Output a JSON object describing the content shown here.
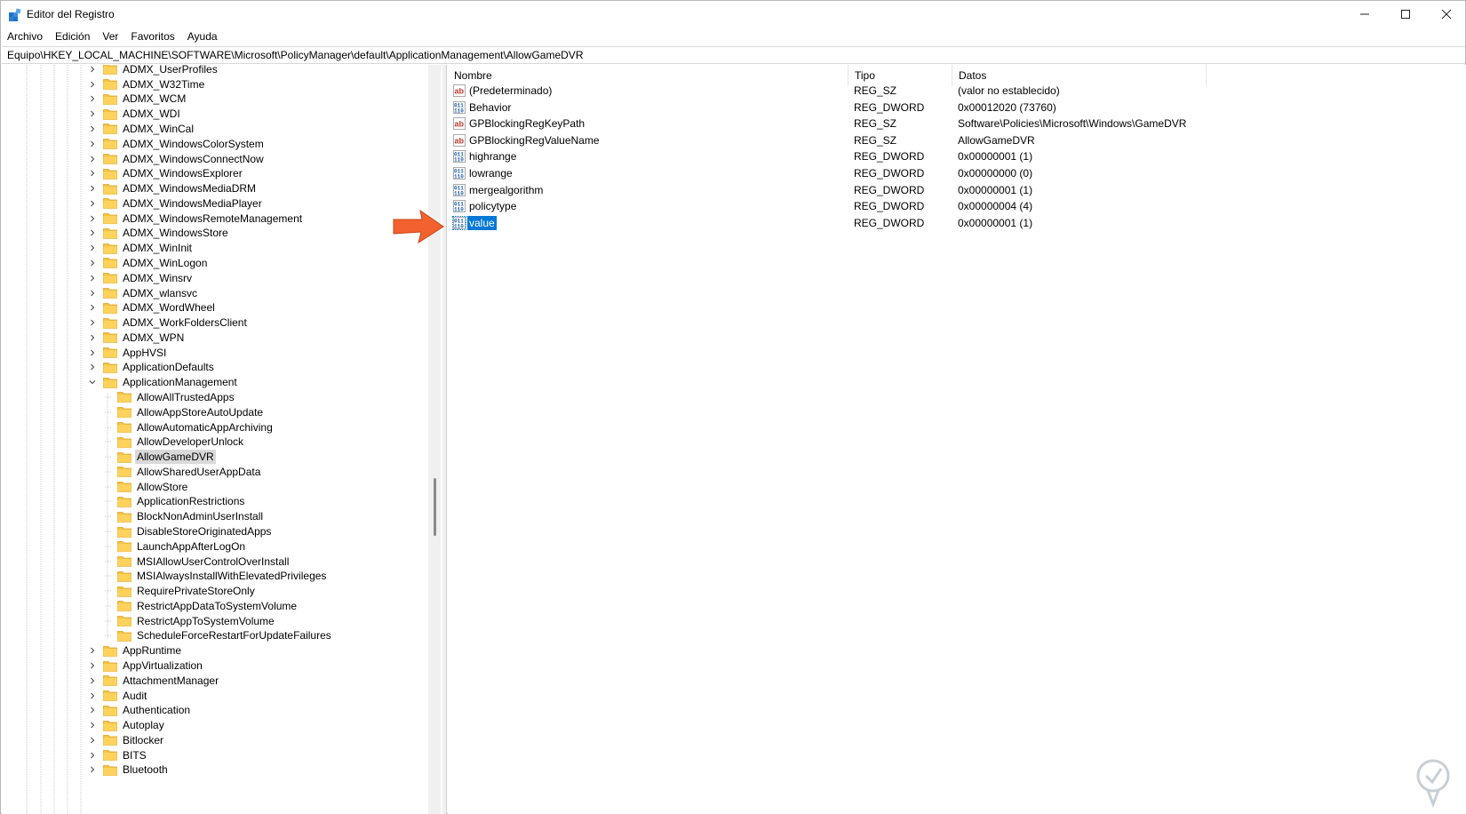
{
  "window": {
    "title": "Editor del Registro"
  },
  "menu": [
    {
      "label": "Archivo"
    },
    {
      "label": "Edición"
    },
    {
      "label": "Ver"
    },
    {
      "label": "Favoritos"
    },
    {
      "label": "Ayuda"
    }
  ],
  "address": {
    "path": "Equipo\\HKEY_LOCAL_MACHINE\\SOFTWARE\\Microsoft\\PolicyManager\\default\\ApplicationManagement\\AllowGameDVR"
  },
  "tree": {
    "items": [
      {
        "label": "ADMX_UserProfiles",
        "level": 0,
        "expander": "collapsed"
      },
      {
        "label": "ADMX_W32Time",
        "level": 0,
        "expander": "collapsed"
      },
      {
        "label": "ADMX_WCM",
        "level": 0,
        "expander": "collapsed"
      },
      {
        "label": "ADMX_WDI",
        "level": 0,
        "expander": "collapsed"
      },
      {
        "label": "ADMX_WinCal",
        "level": 0,
        "expander": "collapsed"
      },
      {
        "label": "ADMX_WindowsColorSystem",
        "level": 0,
        "expander": "collapsed"
      },
      {
        "label": "ADMX_WindowsConnectNow",
        "level": 0,
        "expander": "collapsed"
      },
      {
        "label": "ADMX_WindowsExplorer",
        "level": 0,
        "expander": "collapsed"
      },
      {
        "label": "ADMX_WindowsMediaDRM",
        "level": 0,
        "expander": "collapsed"
      },
      {
        "label": "ADMX_WindowsMediaPlayer",
        "level": 0,
        "expander": "collapsed"
      },
      {
        "label": "ADMX_WindowsRemoteManagement",
        "level": 0,
        "expander": "collapsed"
      },
      {
        "label": "ADMX_WindowsStore",
        "level": 0,
        "expander": "collapsed"
      },
      {
        "label": "ADMX_WinInit",
        "level": 0,
        "expander": "collapsed"
      },
      {
        "label": "ADMX_WinLogon",
        "level": 0,
        "expander": "collapsed"
      },
      {
        "label": "ADMX_Winsrv",
        "level": 0,
        "expander": "collapsed"
      },
      {
        "label": "ADMX_wlansvc",
        "level": 0,
        "expander": "collapsed"
      },
      {
        "label": "ADMX_WordWheel",
        "level": 0,
        "expander": "collapsed"
      },
      {
        "label": "ADMX_WorkFoldersClient",
        "level": 0,
        "expander": "collapsed"
      },
      {
        "label": "ADMX_WPN",
        "level": 0,
        "expander": "collapsed"
      },
      {
        "label": "AppHVSI",
        "level": 0,
        "expander": "collapsed"
      },
      {
        "label": "ApplicationDefaults",
        "level": 0,
        "expander": "collapsed"
      },
      {
        "label": "ApplicationManagement",
        "level": 0,
        "expander": "expanded"
      },
      {
        "label": "AllowAllTrustedApps",
        "level": 1,
        "expander": "none"
      },
      {
        "label": "AllowAppStoreAutoUpdate",
        "level": 1,
        "expander": "none"
      },
      {
        "label": "AllowAutomaticAppArchiving",
        "level": 1,
        "expander": "none"
      },
      {
        "label": "AllowDeveloperUnlock",
        "level": 1,
        "expander": "none"
      },
      {
        "label": "AllowGameDVR",
        "level": 1,
        "expander": "none",
        "selected": true
      },
      {
        "label": "AllowSharedUserAppData",
        "level": 1,
        "expander": "none"
      },
      {
        "label": "AllowStore",
        "level": 1,
        "expander": "none"
      },
      {
        "label": "ApplicationRestrictions",
        "level": 1,
        "expander": "none"
      },
      {
        "label": "BlockNonAdminUserInstall",
        "level": 1,
        "expander": "none"
      },
      {
        "label": "DisableStoreOriginatedApps",
        "level": 1,
        "expander": "none"
      },
      {
        "label": "LaunchAppAfterLogOn",
        "level": 1,
        "expander": "none"
      },
      {
        "label": "MSIAllowUserControlOverInstall",
        "level": 1,
        "expander": "none"
      },
      {
        "label": "MSIAlwaysInstallWithElevatedPrivileges",
        "level": 1,
        "expander": "none"
      },
      {
        "label": "RequirePrivateStoreOnly",
        "level": 1,
        "expander": "none"
      },
      {
        "label": "RestrictAppDataToSystemVolume",
        "level": 1,
        "expander": "none"
      },
      {
        "label": "RestrictAppToSystemVolume",
        "level": 1,
        "expander": "none"
      },
      {
        "label": "ScheduleForceRestartForUpdateFailures",
        "level": 1,
        "expander": "none"
      },
      {
        "label": "AppRuntime",
        "level": 0,
        "expander": "collapsed"
      },
      {
        "label": "AppVirtualization",
        "level": 0,
        "expander": "collapsed"
      },
      {
        "label": "AttachmentManager",
        "level": 0,
        "expander": "collapsed"
      },
      {
        "label": "Audit",
        "level": 0,
        "expander": "collapsed"
      },
      {
        "label": "Authentication",
        "level": 0,
        "expander": "collapsed"
      },
      {
        "label": "Autoplay",
        "level": 0,
        "expander": "collapsed"
      },
      {
        "label": "Bitlocker",
        "level": 0,
        "expander": "collapsed"
      },
      {
        "label": "BITS",
        "level": 0,
        "expander": "collapsed"
      },
      {
        "label": "Bluetooth",
        "level": 0,
        "expander": "collapsed"
      }
    ]
  },
  "list": {
    "columns": {
      "name": "Nombre",
      "type": "Tipo",
      "data": "Datos"
    },
    "rows": [
      {
        "name": "(Predeterminado)",
        "type": "REG_SZ",
        "data": "(valor no establecido)",
        "icon": "string-value-icon"
      },
      {
        "name": "Behavior",
        "type": "REG_DWORD",
        "data": "0x00012020 (73760)",
        "icon": "dword-value-icon"
      },
      {
        "name": "GPBlockingRegKeyPath",
        "type": "REG_SZ",
        "data": "Software\\Policies\\Microsoft\\Windows\\GameDVR",
        "icon": "string-value-icon"
      },
      {
        "name": "GPBlockingRegValueName",
        "type": "REG_SZ",
        "data": "AllowGameDVR",
        "icon": "string-value-icon"
      },
      {
        "name": "highrange",
        "type": "REG_DWORD",
        "data": "0x00000001 (1)",
        "icon": "dword-value-icon"
      },
      {
        "name": "lowrange",
        "type": "REG_DWORD",
        "data": "0x00000000 (0)",
        "icon": "dword-value-icon"
      },
      {
        "name": "mergealgorithm",
        "type": "REG_DWORD",
        "data": "0x00000001 (1)",
        "icon": "dword-value-icon"
      },
      {
        "name": "policytype",
        "type": "REG_DWORD",
        "data": "0x00000004 (4)",
        "icon": "dword-value-icon"
      },
      {
        "name": "value",
        "type": "REG_DWORD",
        "data": "0x00000001 (1)",
        "icon": "dword-value-icon",
        "selected": true
      }
    ]
  },
  "colors": {
    "folder": "#f6c342",
    "selection": "#0078d7",
    "tree_selection": "#d9d9d9",
    "arrow": "#f2622e",
    "string_icon": "#c0392b",
    "dword_icon": "#1f5fa8"
  }
}
